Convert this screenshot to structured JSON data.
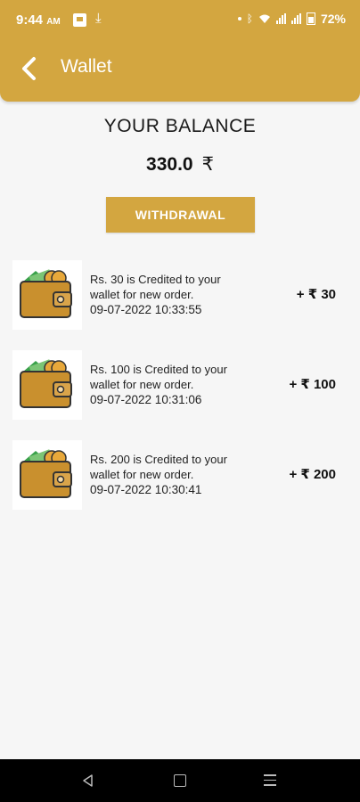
{
  "status_bar": {
    "time": "9:44",
    "ampm": "AM",
    "battery": "72%"
  },
  "header": {
    "title": "Wallet"
  },
  "balance": {
    "heading": "YOUR BALANCE",
    "amount": "330.0",
    "currency": "₹"
  },
  "withdraw": {
    "label": "WITHDRAWAL"
  },
  "transactions": [
    {
      "line1": "Rs. 30 is Credited to your",
      "line2": "wallet for new order.",
      "date": "09-07-2022 10:33:55",
      "amount": "+ ₹ 30"
    },
    {
      "line1": "Rs. 100 is Credited to your",
      "line2": "wallet for new order.",
      "date": "09-07-2022 10:31:06",
      "amount": "+ ₹ 100"
    },
    {
      "line1": "Rs. 200 is Credited to your",
      "line2": "wallet for new order.",
      "date": "09-07-2022 10:30:41",
      "amount": "+ ₹ 200"
    }
  ],
  "icons": {
    "back": "back-arrow-icon",
    "wallet": "wallet-icon",
    "nav_back": "nav-back-icon",
    "nav_home": "nav-home-icon",
    "nav_recent": "nav-recent-icon"
  },
  "colors": {
    "brand": "#d3a640",
    "background": "#f6f6f6"
  }
}
